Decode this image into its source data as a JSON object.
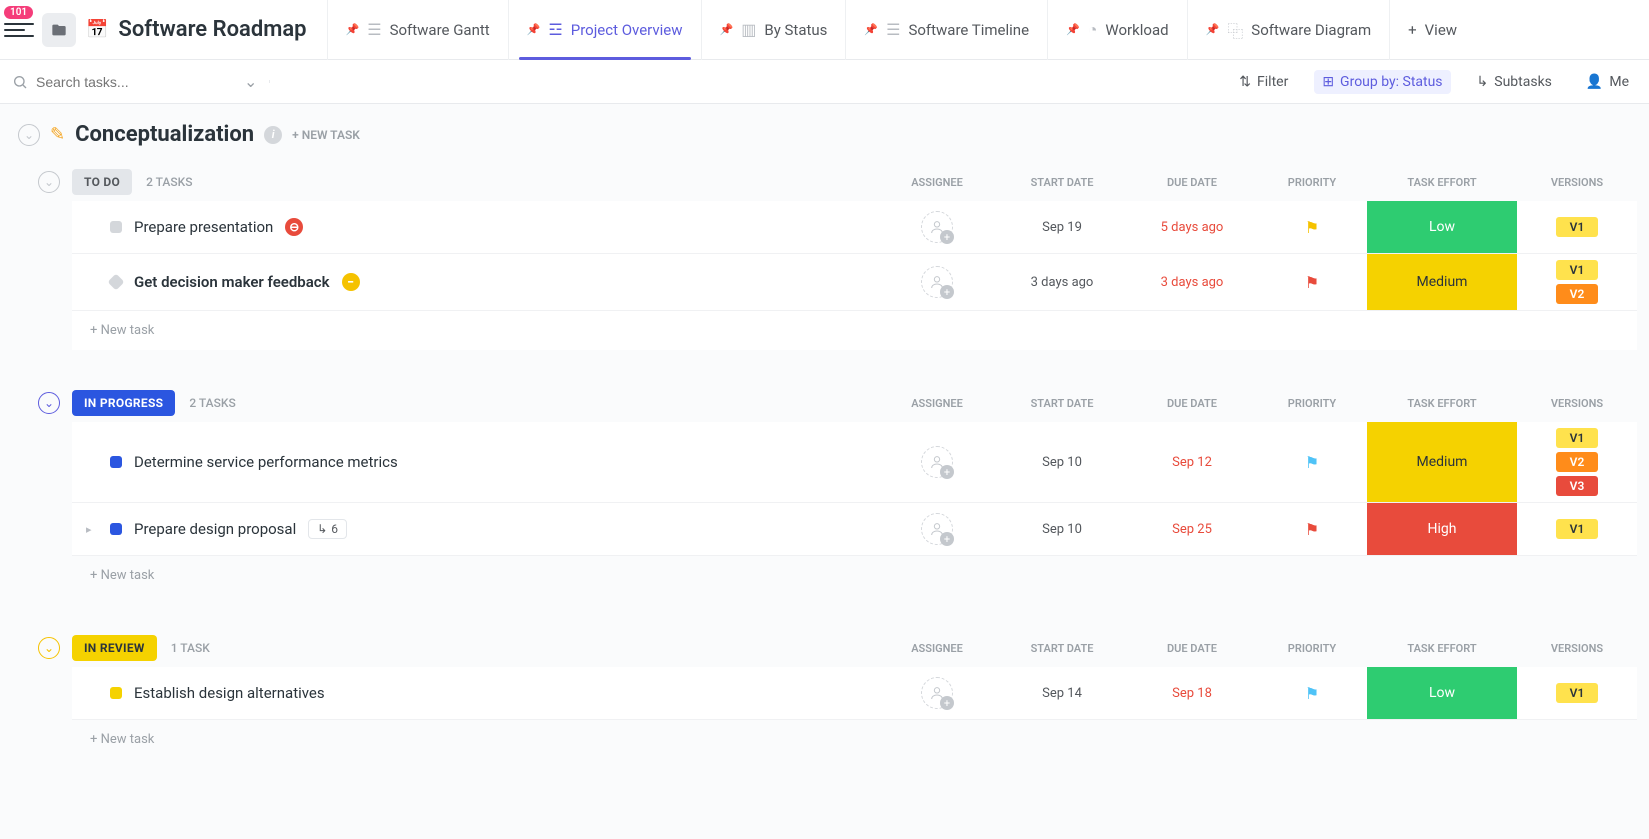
{
  "notificationCount": "101",
  "pageTitle": "Software Roadmap",
  "tabs": [
    {
      "label": "Software Gantt"
    },
    {
      "label": "Project Overview"
    },
    {
      "label": "By Status"
    },
    {
      "label": "Software Timeline"
    },
    {
      "label": "Workload"
    },
    {
      "label": "Software Diagram"
    }
  ],
  "addViewLabel": "View",
  "search": {
    "placeholder": "Search tasks..."
  },
  "toolbar": {
    "filter": "Filter",
    "groupBy": "Group by: Status",
    "subtasks": "Subtasks",
    "me": "Me"
  },
  "section": {
    "title": "Conceptualization",
    "newTask": "+ NEW TASK"
  },
  "columns": {
    "assignee": "ASSIGNEE",
    "startDate": "START DATE",
    "dueDate": "DUE DATE",
    "priority": "PRIORITY",
    "effort": "TASK EFFORT",
    "versions": "VERSIONS"
  },
  "groups": [
    {
      "status": "TO DO",
      "count": "2 TASKS",
      "tasks": [
        {
          "name": "Prepare presentation",
          "start": "Sep 19",
          "due": "5 days ago",
          "effort": "Low",
          "versions": [
            "V1"
          ]
        },
        {
          "name": "Get decision maker feedback",
          "start": "3 days ago",
          "due": "3 days ago",
          "effort": "Medium",
          "versions": [
            "V1",
            "V2"
          ]
        }
      ]
    },
    {
      "status": "IN PROGRESS",
      "count": "2 TASKS",
      "tasks": [
        {
          "name": "Determine service performance metrics",
          "start": "Sep 10",
          "due": "Sep 12",
          "effort": "Medium",
          "versions": [
            "V1",
            "V2",
            "V3"
          ]
        },
        {
          "name": "Prepare design proposal",
          "start": "Sep 10",
          "due": "Sep 25",
          "effort": "High",
          "versions": [
            "V1"
          ],
          "subCount": "6"
        }
      ]
    },
    {
      "status": "IN REVIEW",
      "count": "1 TASK",
      "tasks": [
        {
          "name": "Establish design alternatives",
          "start": "Sep 14",
          "due": "Sep 18",
          "effort": "Low",
          "versions": [
            "V1"
          ]
        }
      ]
    }
  ],
  "newTaskLabel": "+ New task"
}
